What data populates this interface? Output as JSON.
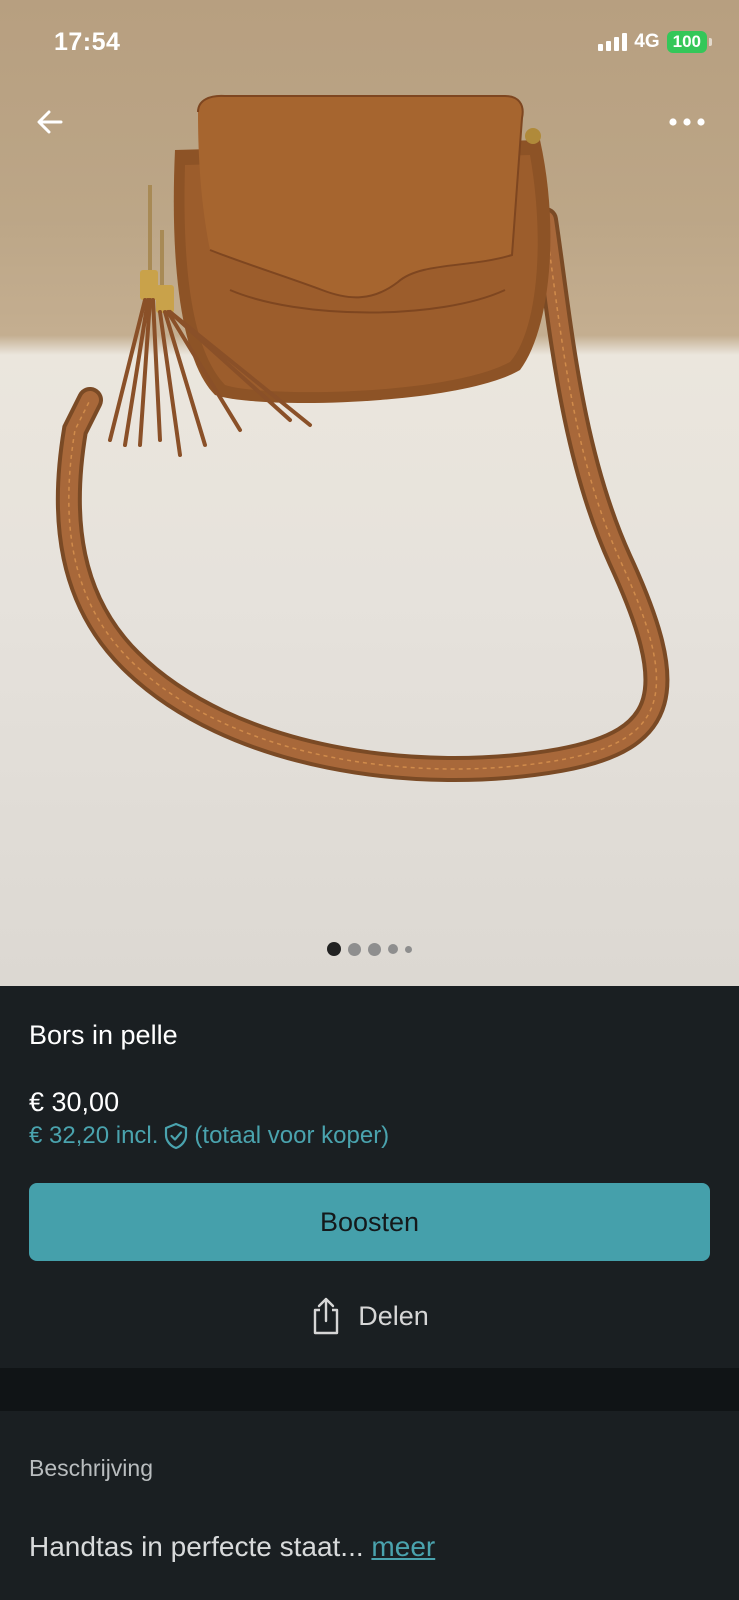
{
  "status_bar": {
    "time": "17:54",
    "network": "4G",
    "battery": "100"
  },
  "nav": {
    "back_icon": "arrow-left-icon",
    "more_icon": "more-horizontal-icon"
  },
  "gallery": {
    "image_count": 5,
    "active_index": 0
  },
  "listing": {
    "title": "Bors in pelle",
    "price": "€ 30,00",
    "price_incl": "€ 32,20 incl.",
    "price_incl_suffix": "(totaal voor koper)",
    "protection_icon": "shield-check-icon"
  },
  "actions": {
    "boost_label": "Boosten",
    "share_label": "Delen",
    "share_icon": "share-icon"
  },
  "description": {
    "heading": "Beschrijving",
    "text": "Handtas in perfecte staat...",
    "more_label": "meer"
  },
  "colors": {
    "accent": "#45a0ab",
    "link": "#4aa3ae",
    "panel_bg": "#1a1f22",
    "battery_green": "#34c759"
  }
}
